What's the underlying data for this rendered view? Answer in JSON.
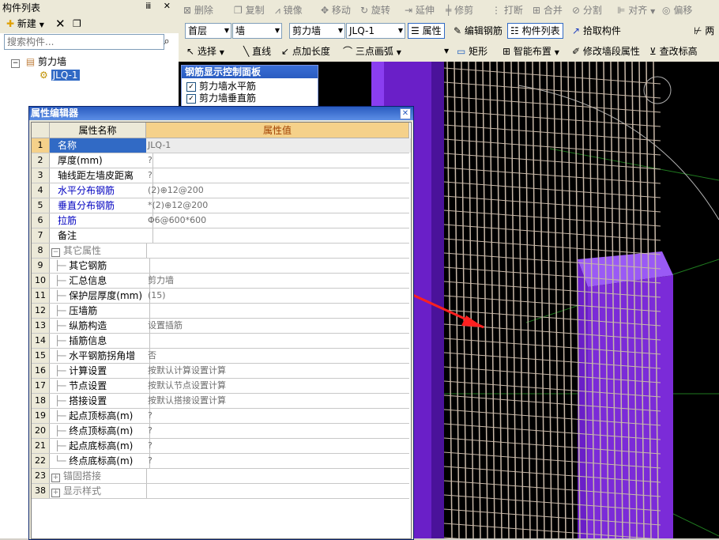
{
  "left_panel": {
    "title": "构件列表",
    "pin": "ⅲ",
    "close": "✕",
    "new_label": "新建",
    "search_placeholder": "搜索构件...",
    "tree_root": "剪力墙",
    "tree_child": "JLQ-1"
  },
  "toolbar1": {
    "delete": "删除",
    "copy": "复制",
    "mirror": "镜像",
    "move": "移动",
    "rotate": "旋转",
    "extend": "延伸",
    "trim": "修剪",
    "break": "打断",
    "merge": "合并",
    "split": "分割",
    "align": "对齐",
    "offset": "偏移"
  },
  "toolbar2": {
    "floor": "首层",
    "type": "墙",
    "subtype": "剪力墙",
    "component": "JLQ-1",
    "property": "属性",
    "edit_rebar": "编辑钢筋",
    "component_list": "构件列表",
    "pick_component": "拾取构件",
    "two": "两"
  },
  "toolbar3": {
    "select": "选择",
    "line": "直线",
    "point_length": "点加长度",
    "three_point_arc": "三点画弧",
    "rect": "矩形",
    "smart_layout": "智能布置",
    "modify_segment": "修改墙段属性",
    "check_elev": "查改标高"
  },
  "control_panel": {
    "title": "钢筋显示控制面板",
    "items": [
      "剪力墙水平筋",
      "剪力墙垂直筋"
    ]
  },
  "prop_editor": {
    "title": "属性编辑器",
    "col_name": "属性名称",
    "col_value": "属性值",
    "rows": [
      {
        "num": "1",
        "name": "名称",
        "value": "JLQ-1"
      },
      {
        "num": "2",
        "name": "厚度(mm)",
        "value": "?"
      },
      {
        "num": "3",
        "name": "轴线距左墙皮距离",
        "value": "?"
      },
      {
        "num": "4",
        "name": "水平分布钢筋",
        "value": "(2)⊕12@200"
      },
      {
        "num": "5",
        "name": "垂直分布钢筋",
        "value": "*(2)⊕12@200"
      },
      {
        "num": "6",
        "name": "拉筋",
        "value": "Φ6@600*600"
      },
      {
        "num": "7",
        "name": "备注",
        "value": ""
      },
      {
        "num": "8",
        "name": "其它属性",
        "value": ""
      },
      {
        "num": "9",
        "name": "其它钢筋",
        "value": ""
      },
      {
        "num": "10",
        "name": "汇总信息",
        "value": "剪力墙"
      },
      {
        "num": "11",
        "name": "保护层厚度(mm)",
        "value": "(15)"
      },
      {
        "num": "12",
        "name": "压墙筋",
        "value": ""
      },
      {
        "num": "13",
        "name": "纵筋构造",
        "value": "设置插筋"
      },
      {
        "num": "14",
        "name": "插筋信息",
        "value": ""
      },
      {
        "num": "15",
        "name": "水平钢筋拐角增",
        "value": "否"
      },
      {
        "num": "16",
        "name": "计算设置",
        "value": "按默认计算设置计算"
      },
      {
        "num": "17",
        "name": "节点设置",
        "value": "按默认节点设置计算"
      },
      {
        "num": "18",
        "name": "搭接设置",
        "value": "按默认搭接设置计算"
      },
      {
        "num": "19",
        "name": "起点顶标高(m)",
        "value": "?"
      },
      {
        "num": "20",
        "name": "终点顶标高(m)",
        "value": "?"
      },
      {
        "num": "21",
        "name": "起点底标高(m)",
        "value": "?"
      },
      {
        "num": "22",
        "name": "终点底标高(m)",
        "value": "?"
      },
      {
        "num": "23",
        "name": "锚固搭接",
        "value": ""
      },
      {
        "num": "38",
        "name": "显示样式",
        "value": ""
      }
    ]
  },
  "colors": {
    "wall": "#7b2bd8",
    "rebar": "#c8b8a8",
    "arrow": "#ff2020",
    "accent": "#316ac5"
  }
}
